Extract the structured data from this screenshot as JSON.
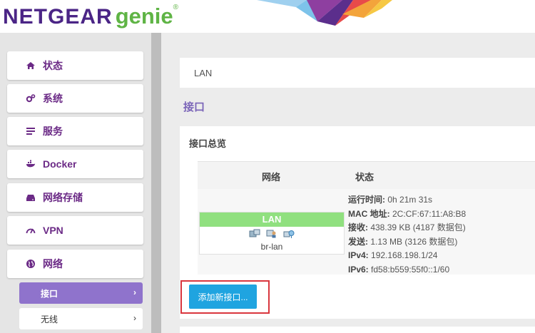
{
  "header": {
    "logo_brand": "NETGEAR",
    "logo_product": "genie",
    "logo_reg": "®"
  },
  "sidebar": {
    "items": [
      {
        "label": "状态",
        "icon": "home-icon"
      },
      {
        "label": "系统",
        "icon": "gears-icon"
      },
      {
        "label": "服务",
        "icon": "list-icon"
      },
      {
        "label": "Docker",
        "icon": "docker-icon"
      },
      {
        "label": "网络存储",
        "icon": "storage-icon"
      },
      {
        "label": "VPN",
        "icon": "gauge-icon"
      },
      {
        "label": "网络",
        "icon": "globe-icon"
      }
    ],
    "sub_items": [
      {
        "label": "接口",
        "active": true,
        "chevron": "›"
      },
      {
        "label": "无线",
        "active": false,
        "chevron": "›"
      }
    ]
  },
  "main": {
    "breadcrumb": "LAN",
    "section_title": "接口",
    "panel_title": "接口总览",
    "table": {
      "col_network": "网络",
      "col_status": "状态"
    },
    "interface": {
      "name": "LAN",
      "device": "br-lan",
      "status_lines": [
        {
          "label": "运行时间:",
          "value": " 0h 21m 31s"
        },
        {
          "label": "MAC 地址:",
          "value": " 2C:CF:67:11:A8:B8"
        },
        {
          "label": "接收:",
          "value": " 438.39 KB (4187 数据包)"
        },
        {
          "label": "发送:",
          "value": " 1.13 MB (3126 数据包)"
        },
        {
          "label": "IPv4:",
          "value": " 192.168.198.1/24"
        },
        {
          "label": "IPv6:",
          "value": " fd58:b559:55f0::1/60"
        }
      ]
    },
    "add_button": "添加新接口..."
  },
  "colors": {
    "brand_purple": "#4b2586",
    "brand_green": "#5fb445",
    "menu_text": "#6b2a86",
    "active_sub": "#8f73cc",
    "iface_green": "#90e07f",
    "button_blue": "#1fa4e0",
    "highlight_red": "#d9363e"
  }
}
